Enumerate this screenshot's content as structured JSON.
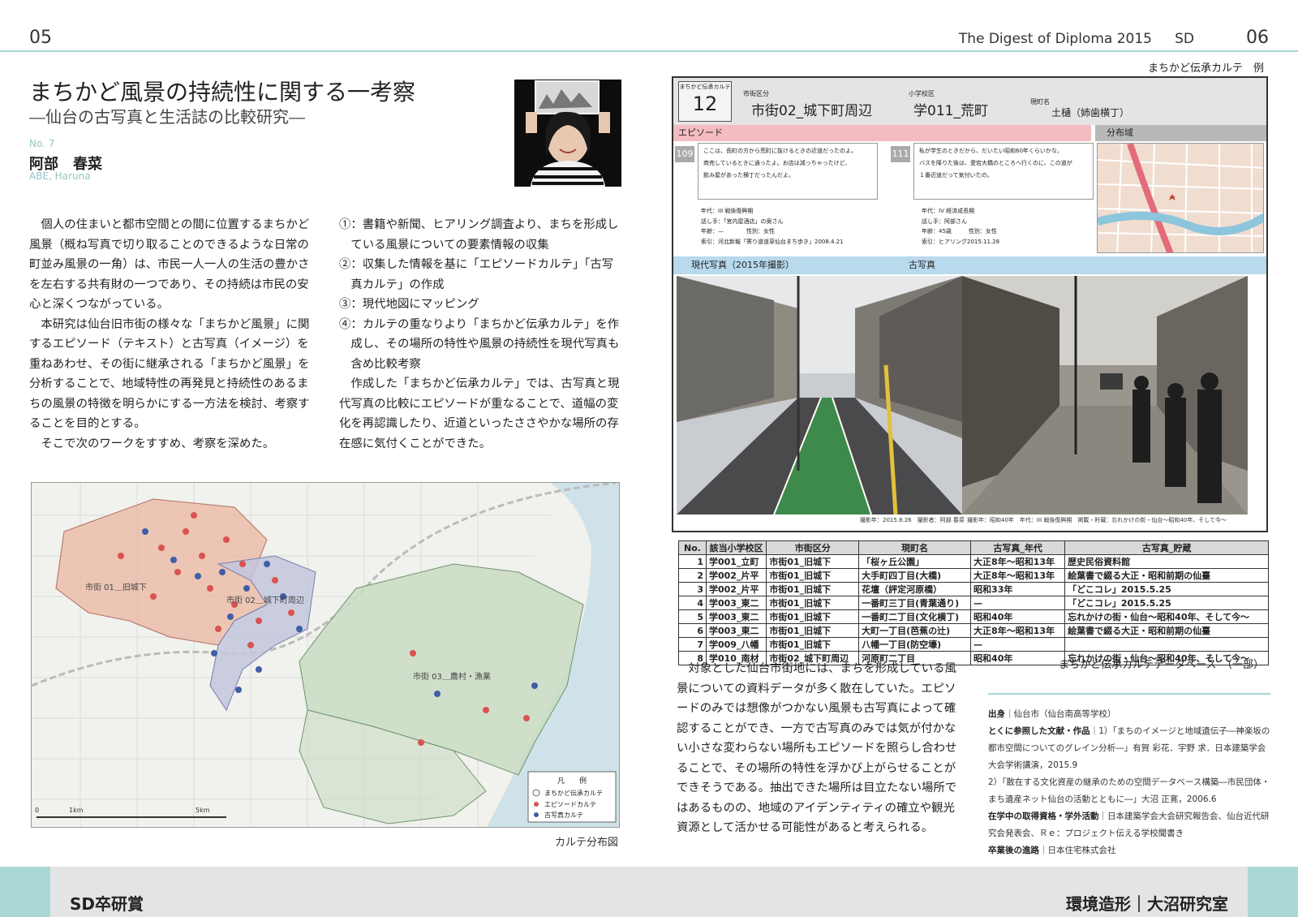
{
  "header": {
    "page_left": "05",
    "page_right": "06",
    "journal": "The Digest of Diploma 2015",
    "journal_abbr": "SD"
  },
  "article": {
    "title": "まちかど風景の持続性に関する一考察",
    "subtitle": "―仙台の古写真と生活誌の比較研究―",
    "number": "No. 7",
    "author": "阿部　春菜",
    "author_en": "ABE, Haruna"
  },
  "body": {
    "col1": [
      "個人の住まいと都市空間との間に位置するまちかど風景（概ね写真で切り取ることのできるような日常の町並み風景の一角）は、市民一人一人の生活の豊かさを左右する共有財の一つであり、その持続は市民の安心と深くつながっている。",
      "本研究は仙台旧市街の様々な「まちかど風景」に関するエピソード（テキスト）と古写真（イメージ）を重ねあわせ、その街に継承される「まちかど風景」を分析することで、地域特性の再発見と持続性のあるまちの風景の特徴を明らかにする一方法を検討、考察することを目的とする。",
      "そこで次のワークをすすめ、考察を深めた。"
    ],
    "col2_items": [
      "①：書籍や新聞、ヒアリング調査より、まちを形成している風景についての要素情報の収集",
      "②：収集した情報を基に「エピソードカルテ」「古写真カルテ」の作成",
      "③：現代地図にマッピング",
      "④：カルテの重なりより「まちかど伝承カルテ」を作成し、その場所の特性や風景の持続性を現代写真も含め比較考察"
    ],
    "col2_para": "作成した「まちかど伝承カルテ」では、古写真と現代写真の比較にエピソードが重なることで、道幅の変化を再認識したり、近道といったささやかな場所の存在感に気付くことができた。",
    "col3": "対象とした仙台市街地には、まちを形成している風景についての資料データが多く散在していた。エピソードのみでは想像がつかない風景も古写真によって確認することができ、一方で古写真のみでは気が付かない小さな変わらない場所もエピソードを照らし合わせることで、その場所の特性を浮かび上がらせることができそうである。抽出できた場所は目立たない場所ではあるものの、地域のアイデンティティの確立や観光資源として活かせる可能性があると考えられる。"
  },
  "map": {
    "caption": "カルテ分布図",
    "area_labels": [
      "市街 01＿旧城下",
      "市街 02＿城下町周辺",
      "市街 03＿農村・漁業"
    ],
    "legend_title": "凡　　例",
    "legend_items": [
      "まちかど伝承カルテ",
      "エピソードカルテ",
      "古写真カルテ"
    ],
    "scale_labels": [
      "0",
      "1km",
      "5km"
    ],
    "colors": {
      "zone1": "#e9b5a0",
      "zone2": "#c3c6dd",
      "zone3": "#c9dcc3",
      "episode": "#d9534f",
      "photo": "#3e5ea8"
    }
  },
  "card": {
    "caption": "まちかど伝承カルテ　例",
    "tag_label": "まちかど伝承カルテ",
    "tag_number": "12",
    "district_label": "市街区分",
    "district": "市街02_城下町周辺",
    "school_label": "小学校区",
    "school": "学011_荒町",
    "street_label": "現町名",
    "street": "土樋（姉歯横丁）",
    "episode_header": "エピソード",
    "dist_header": "分布域",
    "ep1_id": "109",
    "ep1_text": [
      "ここは、長町の方から荒町に抜けるときの近道だったのよ。",
      "商売しているときに通ったよ。お店は減っちゃったけど、",
      "飲み屋があった横丁だったんだよ。"
    ],
    "ep1_meta": [
      "年代：III 戦後復興期",
      "話し手：「宮内屋酒店」の奥さん",
      "年齢：—　　　　性別：女性",
      "索引：河北新報「寄り道道草仙台まち歩き」2008.4.21"
    ],
    "ep2_id": "111",
    "ep2_text": [
      "私が学生のときだから、だいたい昭和60年くらいかな。",
      "バスを降りた後は、愛宕大橋のところへ行くのに、この道が",
      "１番近道だって気付いたの。"
    ],
    "ep2_meta": [
      "年代：IV 経済成長期",
      "話し手：阿部さん",
      "年齢：45歳　　　性別：女性",
      "索引：ヒアリング2015.11.28"
    ],
    "modern_header": "現代写真（2015年撮影）",
    "old_header": "古写真",
    "modern_credit": "撮影年：2015.8.26　撮影者：阿部 春菜",
    "old_credit": "撮影年：昭和40年　年代：III 戦後復興期　掲載・貯蔵：忘れかけの街・仙台〜昭和40年、そして今〜"
  },
  "table": {
    "headers": [
      "No.",
      "該当小学校区",
      "市街区分",
      "現町名",
      "古写真_年代",
      "古写真_貯蔵"
    ],
    "rows": [
      [
        "1",
        "学001_立町",
        "市街01_旧城下",
        "「桜ヶ丘公園」",
        "大正8年～昭和13年",
        "歴史民俗資料館"
      ],
      [
        "2",
        "学002_片平",
        "市街01_旧城下",
        "大手町四丁目(大橋)",
        "大正8年～昭和13年",
        "絵葉書で綴る大正・昭和前期の仙臺"
      ],
      [
        "3",
        "学002_片平",
        "市街01_旧城下",
        "花壇（評定河原橋）",
        "昭和33年",
        "「どこコレ」2015.5.25"
      ],
      [
        "4",
        "学003_東二",
        "市街01_旧城下",
        "一番町三丁目(青葉通り)",
        "—",
        "「どこコレ」2015.5.25"
      ],
      [
        "5",
        "学003_東二",
        "市街01_旧城下",
        "一番町二丁目(文化横丁)",
        "昭和40年",
        "忘れかけの街・仙台〜昭和40年、そして今〜"
      ],
      [
        "6",
        "学003_東二",
        "市街01_旧城下",
        "大町一丁目(芭蕉の辻)",
        "大正8年～昭和13年",
        "絵葉書で綴る大正・昭和前期の仙臺"
      ],
      [
        "7",
        "学009_八幡",
        "市街01_旧城下",
        "八幡一丁目(防空壕)",
        "—",
        ""
      ],
      [
        "8",
        "学010_南材",
        "市街02_城下町周辺",
        "河原町二丁目",
        "昭和40年",
        "忘れかけの街・仙台〜昭和40年、そして今〜"
      ]
    ],
    "caption": "まちかど伝承カルテデータベース　（一部）"
  },
  "info": {
    "origin_label": "出身",
    "origin": "仙台市（仙台南高等学校）",
    "refs_label": "とくに参照した文献・作品",
    "ref1": "1）「まちのイメージと地域遺伝子―神楽坂の都市空間についてのグレイン分析―」有賀 彩花．宇野 求．日本建築学会大会学術講演，2015.9",
    "ref2": "2）「散在する文化資産の継承のための空間データベース構築―市民団体・まち遺産ネット仙台の活動とともに―」大沼 正寛，2006.6",
    "quals_label": "在学中の取得資格・学外活動",
    "quals": "日本建築学会大会研究報告会、仙台近代研究会発表会、Ｒｅ：プロジェクト伝える学校聞書き",
    "career_label": "卒業後の進路",
    "career": "日本住宅株式会社"
  },
  "footer": {
    "left": "SD卒研賞",
    "right": "環境造形｜大沼研究室"
  }
}
